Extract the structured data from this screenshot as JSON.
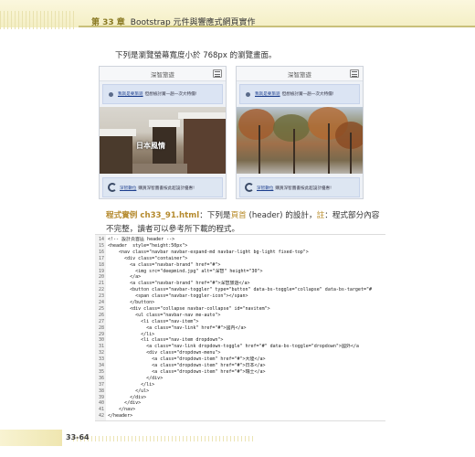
{
  "header": {
    "chapter": "第 33 章",
    "title": "Bootstrap 元件與響應式網頁實作"
  },
  "intro": "下列是瀏覽螢幕寬度小於 768px 的瀏覽畫面。",
  "screens": [
    {
      "brand": "深智旅遊",
      "alert_link": "我就是要旅遊",
      "alert_text": "但想檢討賞一趟一次大特價!",
      "photo_caption": "日本風情",
      "footer_link": "深智數位",
      "footer_text": "購買深智圖書按此超設計優惠!"
    },
    {
      "brand": "深智旅遊",
      "alert_link": "我就是要旅遊",
      "alert_text": "但想檢討賞一趟一次大特價!",
      "footer_link": "深智數位",
      "footer_text": "購買深智圖書按此超設計優惠!"
    }
  ],
  "caption": {
    "label": "程式實例 ch33_91.html",
    "t1": "：下列是",
    "h1": "頁首",
    "t2": " (header) 的設計，",
    "h2": "註",
    "t3": "：程式部分內容不完整，讀者可以參考所下載的程式。"
  },
  "code": [
    {
      "n": "14",
      "t": "<!-- 設計頁首區 header -->"
    },
    {
      "n": "15",
      "t": "<header  style=\"height:50px\">"
    },
    {
      "n": "16",
      "t": "    <nav class=\"navbar navbar-expand-md navbar-light bg-light fixed-top\">"
    },
    {
      "n": "17",
      "t": "      <div class=\"container\">"
    },
    {
      "n": "18",
      "t": "        <a class=\"navbar-brand\" href=\"#\">"
    },
    {
      "n": "19",
      "t": "          <img src=\"deepmind.jpg\" alt=\"深智\" height=\"30\">"
    },
    {
      "n": "20",
      "t": "        </a>"
    },
    {
      "n": "21",
      "t": "        <a class=\"navbar-brand\" href=\"#\">深智旅遊</a>"
    },
    {
      "n": "22",
      "t": "        <button class=\"navbar-toggler\" type=\"button\" data-bs-toggle=\"collapse\" data-bs-target=\"#"
    },
    {
      "n": "23",
      "t": "          <span class=\"navbar-toggler-icon\"></span>"
    },
    {
      "n": "24",
      "t": "        </button>"
    },
    {
      "n": "25",
      "t": "        <div class=\"collapse navbar-collapse\" id=\"navitem\">"
    },
    {
      "n": "26",
      "t": "          <ul class=\"navbar-nav me-auto\">"
    },
    {
      "n": "27",
      "t": "            <li class=\"nav-item\">"
    },
    {
      "n": "28",
      "t": "              <a class=\"nav-link\" href=\"#\">國內</a>"
    },
    {
      "n": "29",
      "t": "            </li>"
    },
    {
      "n": "30",
      "t": "            <li class=\"nav-item dropdown\">"
    },
    {
      "n": "31",
      "t": "              <a class=\"nav-link dropdown-toggle\" href=\"#\" data-bs-toggle=\"dropdown\">國外</a"
    },
    {
      "n": "32",
      "t": "              <div class=\"dropdown-menu\">"
    },
    {
      "n": "33",
      "t": "                <a class=\"dropdown-item\" href=\"#\">大陸</a>"
    },
    {
      "n": "34",
      "t": "                <a class=\"dropdown-item\" href=\"#\">日本</a>"
    },
    {
      "n": "35",
      "t": "                <a class=\"dropdown-item\" href=\"#\">瑞士</a>"
    },
    {
      "n": "36",
      "t": "              </div>"
    },
    {
      "n": "37",
      "t": "            </li>"
    },
    {
      "n": "38",
      "t": "          </ul>"
    },
    {
      "n": "39",
      "t": "        </div>"
    },
    {
      "n": "40",
      "t": "      </div>"
    },
    {
      "n": "41",
      "t": "    </nav>"
    },
    {
      "n": "42",
      "t": "</header>"
    }
  ],
  "page_number": "33-64"
}
